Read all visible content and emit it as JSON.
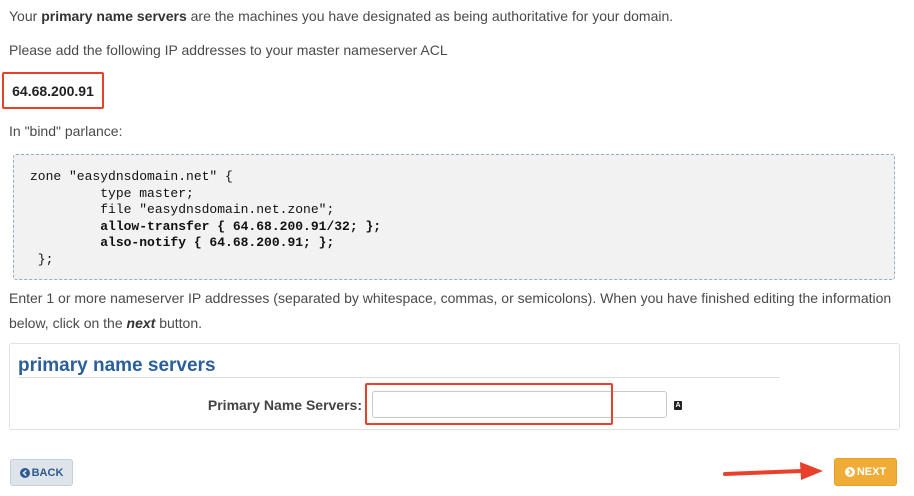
{
  "intro": {
    "pre": "Your ",
    "bold": "primary name servers",
    "post": " are the machines you have designated as being authoritative for your domain."
  },
  "acl_text": "Please add the following IP addresses to your master nameserver ACL",
  "ip_address": "64.68.200.91",
  "bind_label": "In \"bind\" parlance:",
  "code_lines": {
    "l1": "zone \"easydnsdomain.net\" {",
    "l2": "         type master;",
    "l3": "         file \"easydnsdomain.net.zone\";",
    "l4": "         allow-transfer { 64.68.200.91/32; };",
    "l5": "         also-notify { 64.68.200.91; };",
    "l6": " };"
  },
  "instructions": {
    "line1": "Enter 1 or more nameserver IP addresses (separated by whitespace, commas, or semicolons). When you have finished editing the information",
    "line2_pre": "below, click on the ",
    "line2_em": "next",
    "line2_post": " button."
  },
  "panel": {
    "title": "primary name servers",
    "field_label": "Primary Name Servers:",
    "field_value": ""
  },
  "buttons": {
    "back": "BACK",
    "next": "NEXT"
  },
  "colors": {
    "highlight": "#e8402a",
    "panel_title": "#2a5f99",
    "next_button": "#f0ac36",
    "back_button": "#dfe4ea"
  },
  "icons": {
    "back": "circle-arrow-left-icon",
    "next": "circle-arrow-right-icon",
    "field_helper": "keyboard-icon"
  }
}
